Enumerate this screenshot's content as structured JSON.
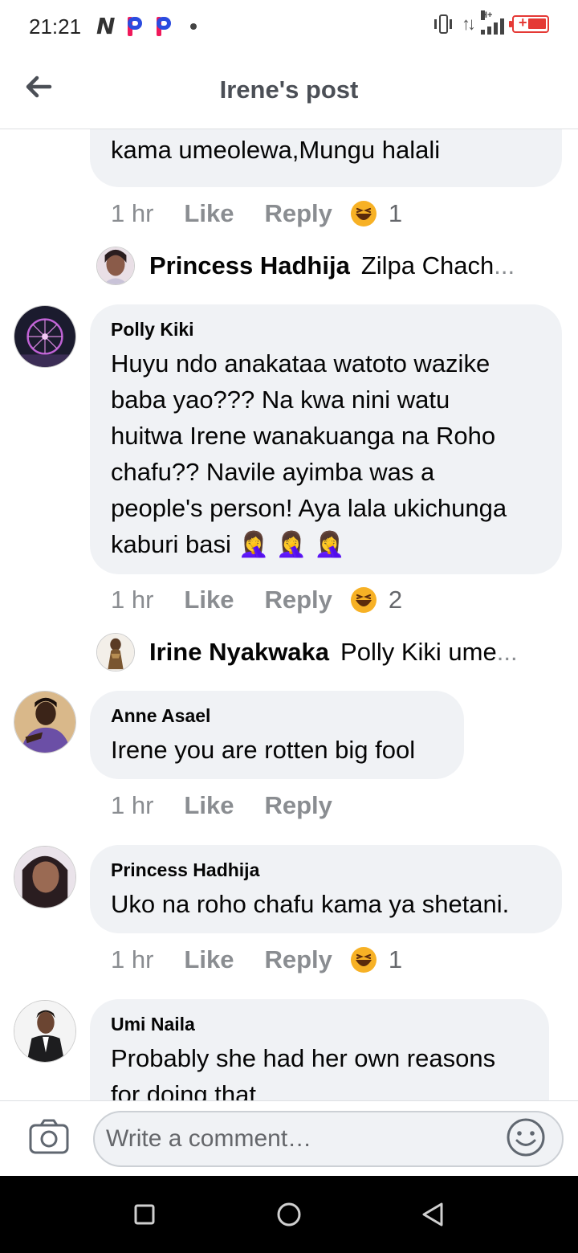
{
  "status": {
    "time": "21:21",
    "icons": [
      "n-notification-icon",
      "p-app-icon",
      "p-app-icon",
      "dot-icon",
      "vibrate-icon",
      "data-arrows-icon",
      "signal-hplus-icon",
      "battery-charging-icon"
    ],
    "signal_label": "H+"
  },
  "header": {
    "title": "Irene's post",
    "back_icon": "arrow-left-icon"
  },
  "colors": {
    "bubble": "#f0f2f5",
    "meta_text": "#8a8d91",
    "title_text": "#4b4f56",
    "battery": "#e53935"
  },
  "comments": [
    {
      "text": "kama umeolewa,Mungu halali",
      "time": "1 hr",
      "like": "Like",
      "reply": "Reply",
      "reaction_count": "1",
      "reply_preview": {
        "name": "Princess Hadhija",
        "text": "Zilpa Chach",
        "ellipsis": "..."
      }
    },
    {
      "author": "Polly Kiki",
      "lines": [
        "Huyu ndo anakataa watoto wazike",
        "baba yao??? Na kwa nini watu",
        "huitwa Irene wanakuanga na Roho",
        "chafu?? Navile ayimba was a",
        "people's person! Aya lala ukichunga",
        "kaburi basi 🤦‍♀️ 🤦‍♀️ 🤦‍♀️"
      ],
      "time": "1 hr",
      "like": "Like",
      "reply": "Reply",
      "reaction_count": "2",
      "reply_preview": {
        "name": "Irine Nyakwaka",
        "text": "Polly Kiki ume",
        "ellipsis": "..."
      }
    },
    {
      "author": "Anne Asael",
      "text": "Irene you are rotten big fool",
      "time": "1 hr",
      "like": "Like",
      "reply": "Reply"
    },
    {
      "author": "Princess Hadhija",
      "text": "Uko na roho chafu kama ya shetani.",
      "time": "1 hr",
      "like": "Like",
      "reply": "Reply",
      "reaction_count": "1"
    },
    {
      "author": "Umi Naila",
      "lines": [
        "Probably she had her own reasons",
        "for doing that"
      ]
    }
  ],
  "composer": {
    "placeholder": "Write a comment…"
  }
}
